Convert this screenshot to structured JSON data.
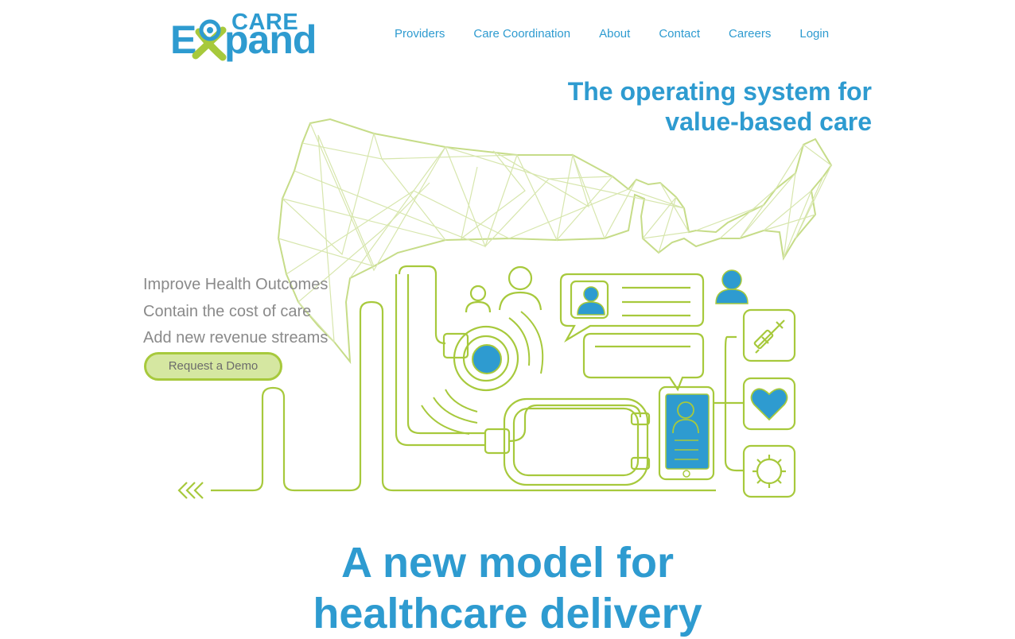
{
  "logo": {
    "care": "CARE",
    "e": "E",
    "pand": "pand"
  },
  "nav": {
    "providers": "Providers",
    "care_coordination": "Care Coordination",
    "about": "About",
    "contact": "Contact",
    "careers": "Careers",
    "login": "Login"
  },
  "hero": {
    "title_line1": "The operating system for",
    "title_line2": "value-based care",
    "bullet1": "Improve Health Outcomes",
    "bullet2": "Contain the cost of care",
    "bullet3": "Add new revenue streams",
    "demo_button": "Request a Demo"
  },
  "model": {
    "line1": "A new model for",
    "line2": "healthcare delivery"
  },
  "colors": {
    "brand_blue": "#2e9bd0",
    "brand_green": "#a7c93c",
    "button_fill": "#d5e7a1",
    "muted_text": "#8a8a8a"
  },
  "icons": [
    "us-map-network",
    "stethoscope-icon",
    "syringe-icon",
    "heart-icon",
    "virus-icon",
    "person-icon",
    "phone-icon",
    "chat-bubble-icon"
  ]
}
